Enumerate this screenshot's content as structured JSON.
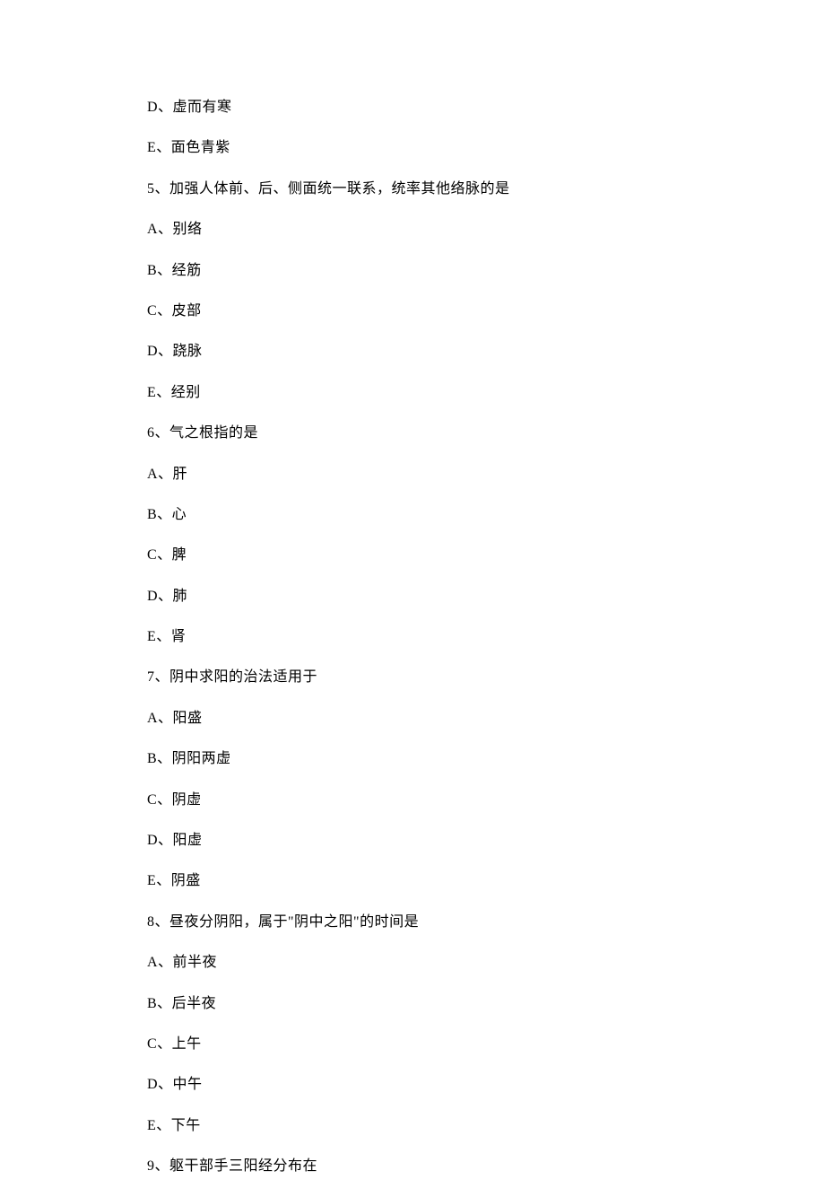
{
  "lines": [
    "D、虚而有寒",
    "E、面色青紫",
    "5、加强人体前、后、侧面统一联系，统率其他络脉的是",
    "A、别络",
    "B、经筋",
    "C、皮部",
    "D、跷脉",
    "E、经别",
    "6、气之根指的是",
    "A、肝",
    "B、心",
    "C、脾",
    "D、肺",
    "E、肾",
    "7、阴中求阳的治法适用于",
    "A、阳盛",
    "B、阴阳两虚",
    "C、阴虚",
    "D、阳虚",
    "E、阴盛",
    "8、昼夜分阴阳，属于\"阴中之阳\"的时间是",
    "A、前半夜",
    "B、后半夜",
    "C、上午",
    "D、中午",
    "E、下午",
    "9、躯干部手三阳经分布在"
  ]
}
